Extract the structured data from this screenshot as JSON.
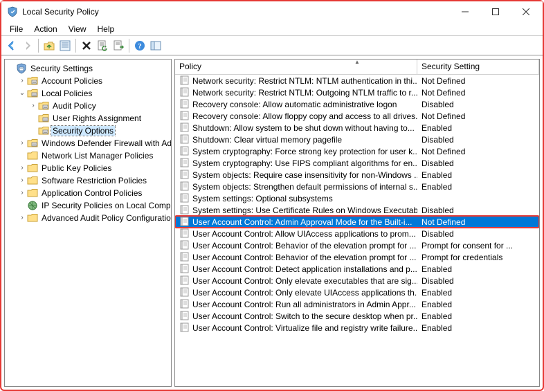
{
  "window": {
    "title": "Local Security Policy"
  },
  "menu": {
    "items": [
      "File",
      "Action",
      "View",
      "Help"
    ]
  },
  "toolbar": {
    "icons": [
      "back-arrow-icon",
      "forward-arrow-icon",
      "sep",
      "up-folder-icon",
      "properties-icon",
      "sep",
      "delete-icon",
      "refresh-icon",
      "export-list-icon",
      "sep",
      "help-icon",
      "show-hide-icon"
    ]
  },
  "tree": {
    "root_label": "Security Settings",
    "nodes": [
      {
        "label": "Account Policies",
        "depth": 1,
        "expander": ">",
        "icon": "folder"
      },
      {
        "label": "Local Policies",
        "depth": 1,
        "expander": "v",
        "icon": "folder"
      },
      {
        "label": "Audit Policy",
        "depth": 2,
        "expander": ">",
        "icon": "folder"
      },
      {
        "label": "User Rights Assignment",
        "depth": 2,
        "expander": "",
        "icon": "folder"
      },
      {
        "label": "Security Options",
        "depth": 2,
        "expander": "",
        "icon": "folder",
        "selected": true
      },
      {
        "label": "Windows Defender Firewall with Adva",
        "depth": 1,
        "expander": ">",
        "icon": "folder"
      },
      {
        "label": "Network List Manager Policies",
        "depth": 1,
        "expander": "",
        "icon": "folder-plain"
      },
      {
        "label": "Public Key Policies",
        "depth": 1,
        "expander": ">",
        "icon": "folder-plain"
      },
      {
        "label": "Software Restriction Policies",
        "depth": 1,
        "expander": ">",
        "icon": "folder-plain"
      },
      {
        "label": "Application Control Policies",
        "depth": 1,
        "expander": ">",
        "icon": "folder-plain"
      },
      {
        "label": "IP Security Policies on Local Compute",
        "depth": 1,
        "expander": "",
        "icon": "ipsec"
      },
      {
        "label": "Advanced Audit Policy Configuration",
        "depth": 1,
        "expander": ">",
        "icon": "folder-plain"
      }
    ]
  },
  "list": {
    "columns": {
      "policy": "Policy",
      "setting": "Security Setting"
    },
    "rows": [
      {
        "policy": "Network security: Restrict NTLM: NTLM authentication in thi...",
        "setting": "Not Defined"
      },
      {
        "policy": "Network security: Restrict NTLM: Outgoing NTLM traffic to r...",
        "setting": "Not Defined"
      },
      {
        "policy": "Recovery console: Allow automatic administrative logon",
        "setting": "Disabled"
      },
      {
        "policy": "Recovery console: Allow floppy copy and access to all drives...",
        "setting": "Not Defined"
      },
      {
        "policy": "Shutdown: Allow system to be shut down without having to...",
        "setting": "Enabled"
      },
      {
        "policy": "Shutdown: Clear virtual memory pagefile",
        "setting": "Disabled"
      },
      {
        "policy": "System cryptography: Force strong key protection for user k...",
        "setting": "Not Defined"
      },
      {
        "policy": "System cryptography: Use FIPS compliant algorithms for en...",
        "setting": "Disabled"
      },
      {
        "policy": "System objects: Require case insensitivity for non-Windows ...",
        "setting": "Enabled"
      },
      {
        "policy": "System objects: Strengthen default permissions of internal s...",
        "setting": "Enabled"
      },
      {
        "policy": "System settings: Optional subsystems",
        "setting": ""
      },
      {
        "policy": "System settings: Use Certificate Rules on Windows Executab...",
        "setting": "Disabled"
      },
      {
        "policy": "User Account Control: Admin Approval Mode for the Built-i...",
        "setting": "Not Defined",
        "selected": true,
        "highlighted": true
      },
      {
        "policy": "User Account Control: Allow UIAccess applications to prom...",
        "setting": "Disabled"
      },
      {
        "policy": "User Account Control: Behavior of the elevation prompt for ...",
        "setting": "Prompt for consent for ..."
      },
      {
        "policy": "User Account Control: Behavior of the elevation prompt for ...",
        "setting": "Prompt for credentials"
      },
      {
        "policy": "User Account Control: Detect application installations and p...",
        "setting": "Enabled"
      },
      {
        "policy": "User Account Control: Only elevate executables that are sig...",
        "setting": "Disabled"
      },
      {
        "policy": "User Account Control: Only elevate UIAccess applications th...",
        "setting": "Enabled"
      },
      {
        "policy": "User Account Control: Run all administrators in Admin Appr...",
        "setting": "Enabled"
      },
      {
        "policy": "User Account Control: Switch to the secure desktop when pr...",
        "setting": "Enabled"
      },
      {
        "policy": "User Account Control: Virtualize file and registry write failure...",
        "setting": "Enabled"
      }
    ]
  }
}
